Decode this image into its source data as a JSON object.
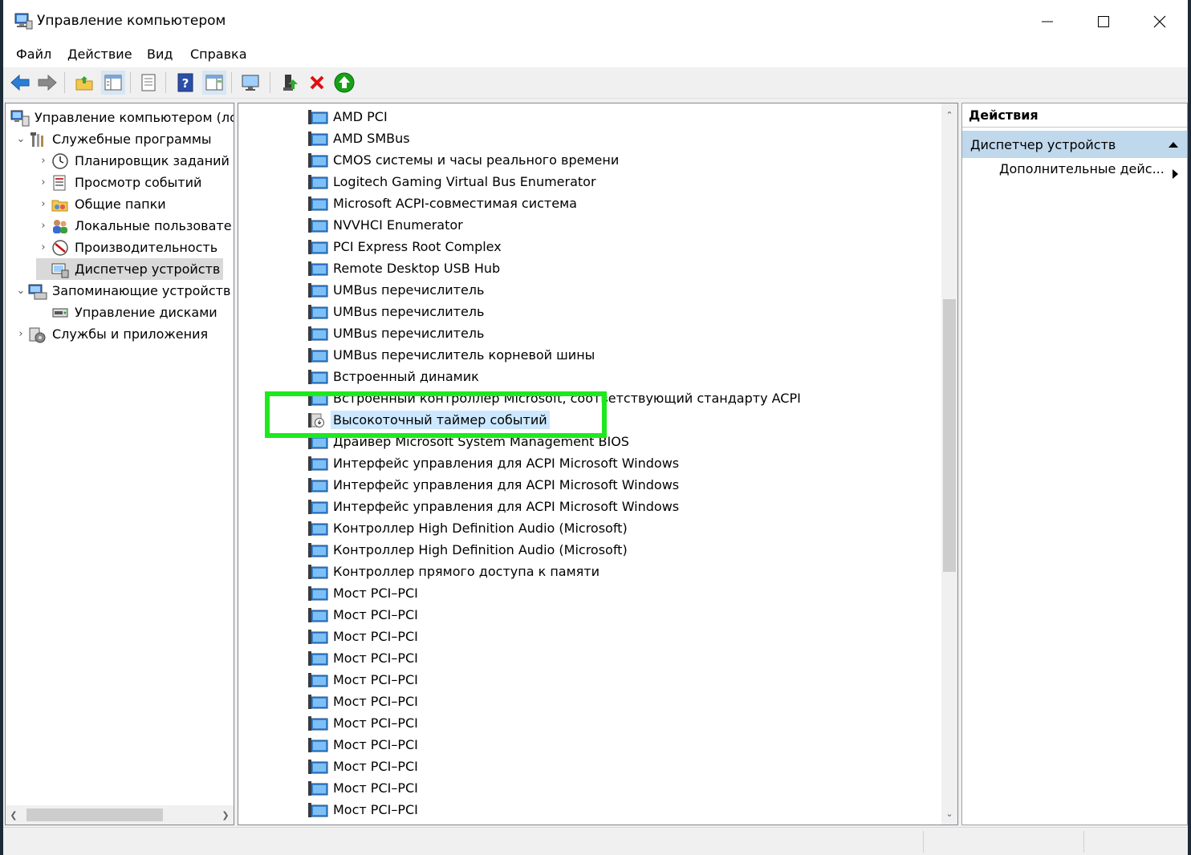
{
  "window": {
    "title": "Управление компьютером"
  },
  "menu": [
    "Файл",
    "Действие",
    "Вид",
    "Справка"
  ],
  "left_tree": [
    {
      "label": "Управление компьютером (лс",
      "level": 0,
      "expander": "",
      "icon": "computer-management-icon"
    },
    {
      "label": "Служебные программы",
      "level": 1,
      "expander": "expanded",
      "icon": "tools-icon"
    },
    {
      "label": "Планировщик заданий",
      "level": 2,
      "expander": "collapsed",
      "icon": "clock-icon"
    },
    {
      "label": "Просмотр событий",
      "level": 2,
      "expander": "collapsed",
      "icon": "event-viewer-icon"
    },
    {
      "label": "Общие папки",
      "level": 2,
      "expander": "collapsed",
      "icon": "shared-folder-icon"
    },
    {
      "label": "Локальные пользовате",
      "level": 2,
      "expander": "collapsed",
      "icon": "users-icon"
    },
    {
      "label": "Производительность",
      "level": 2,
      "expander": "collapsed",
      "icon": "performance-icon"
    },
    {
      "label": "Диспетчер устройств",
      "level": 2,
      "expander": "",
      "icon": "device-manager-icon",
      "selected": true
    },
    {
      "label": "Запоминающие устройств",
      "level": 1,
      "expander": "expanded",
      "icon": "storage-icon"
    },
    {
      "label": "Управление дисками",
      "level": 2,
      "expander": "",
      "icon": "disk-icon"
    },
    {
      "label": "Службы и приложения",
      "level": 1,
      "expander": "collapsed",
      "icon": "services-icon"
    }
  ],
  "devices": [
    "AMD PCI",
    "AMD SMBus",
    "CMOS системы и часы реального времени",
    "Logitech Gaming Virtual Bus Enumerator",
    "Microsoft ACPI-совместимая система",
    "NVVHCI Enumerator",
    "PCI Express Root Complex",
    "Remote Desktop USB Hub",
    "UMBus перечислитель",
    "UMBus перечислитель",
    "UMBus перечислитель",
    "UMBus перечислитель корневой шины",
    "Встроенный динамик",
    "Встроенный контроллер Microsoft, соответствующий стандарту ACPI",
    "Высокоточный таймер событий",
    "Драйвер Microsoft System Management BIOS",
    "Интерфейс управления для ACPI Microsoft Windows",
    "Интерфейс управления для ACPI Microsoft Windows",
    "Интерфейс управления для ACPI Microsoft Windows",
    "Контроллер High Definition Audio (Microsoft)",
    "Контроллер High Definition Audio (Microsoft)",
    "Контроллер прямого доступа к памяти",
    "Мост PCI–PCI",
    "Мост PCI–PCI",
    "Мост PCI–PCI",
    "Мост PCI–PCI",
    "Мост PCI–PCI",
    "Мост PCI–PCI",
    "Мост PCI–PCI",
    "Мост PCI–PCI",
    "Мост PCI–PCI",
    "Мост PCI–PCI",
    "Мост PCI–PCI"
  ],
  "selected_device_index": 14,
  "actions": {
    "header": "Действия",
    "section": "Диспетчер устройств",
    "more": "Дополнительные дейс..."
  },
  "colors": {
    "highlight_box": "#1ee81e",
    "selection": "#cce8ff",
    "actions_section": "#c0d8ec"
  }
}
